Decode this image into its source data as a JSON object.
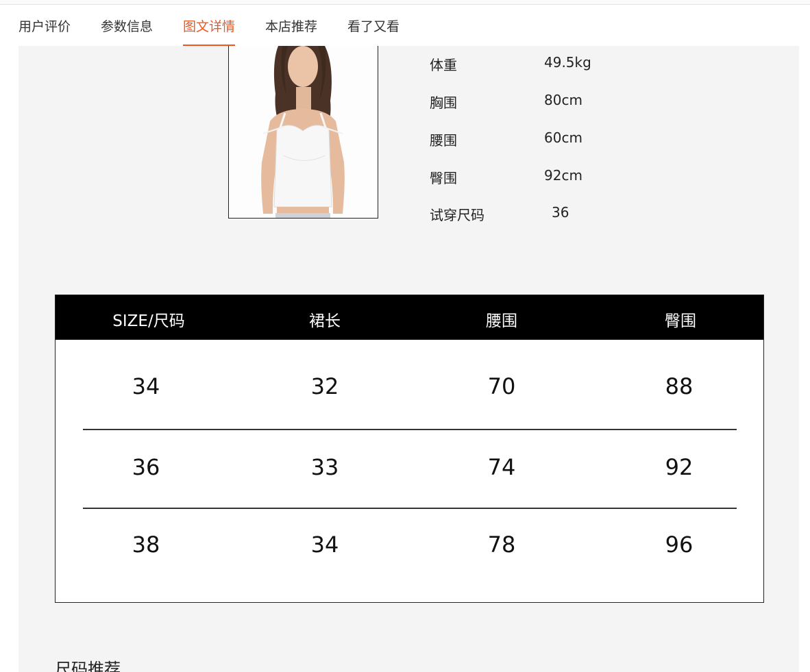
{
  "tabs": [
    {
      "label": "用户评价",
      "active": false
    },
    {
      "label": "参数信息",
      "active": false
    },
    {
      "label": "图文详情",
      "active": true
    },
    {
      "label": "本店推荐",
      "active": false
    },
    {
      "label": "看了又看",
      "active": false
    }
  ],
  "accent_color": "#f0561d",
  "model_specs": [
    {
      "label": "体重",
      "value": "49.5kg"
    },
    {
      "label": "胸围",
      "value": "80cm"
    },
    {
      "label": "腰围",
      "value": "60cm"
    },
    {
      "label": "臀围",
      "value": "92cm"
    },
    {
      "label": "试穿尺码",
      "value": "36"
    }
  ],
  "size_table": {
    "headers": [
      "SIZE/尺码",
      "裙长",
      "腰围",
      "臀围"
    ],
    "rows": [
      [
        "34",
        "32",
        "70",
        "88"
      ],
      [
        "36",
        "33",
        "74",
        "92"
      ],
      [
        "38",
        "34",
        "78",
        "96"
      ]
    ]
  },
  "size_recommend_title": "尺码推荐"
}
